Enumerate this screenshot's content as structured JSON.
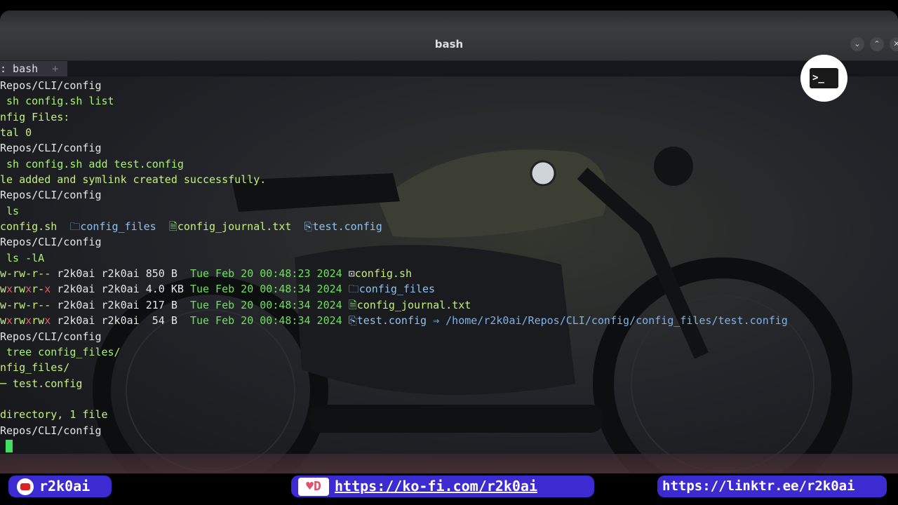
{
  "window": {
    "title": "bash",
    "buttons": [
      "⌄",
      "⌃",
      "✕"
    ]
  },
  "tabs": {
    "active_label": ": bash",
    "new_tab": "+"
  },
  "terminal_lines": [
    [
      {
        "t": "Repos/CLI/config",
        "c": "w"
      }
    ],
    [
      {
        "t": " sh config.sh list",
        "c": "g"
      }
    ],
    [
      {
        "t": "nfig Files:",
        "c": "gt"
      }
    ],
    [
      {
        "t": "tal 0",
        "c": "gt"
      }
    ],
    [
      {
        "t": "Repos/CLI/config",
        "c": "w"
      }
    ],
    [
      {
        "t": " sh config.sh add test.config",
        "c": "g"
      }
    ],
    [
      {
        "t": "le added and symlink created successfully.",
        "c": "gt"
      }
    ],
    [
      {
        "t": "Repos/CLI/config",
        "c": "w"
      }
    ],
    [
      {
        "t": " ls",
        "c": "g"
      }
    ],
    [
      {
        "t": "config.sh ",
        "c": "gt"
      },
      {
        "t": " 🗀config_files ",
        "c": "b"
      },
      {
        "t": " 🗎",
        "c": "d"
      },
      {
        "t": "config_journal.txt ",
        "c": "gt"
      },
      {
        "t": " ⎘test.config",
        "c": "b"
      }
    ],
    [
      {
        "t": "Repos/CLI/config",
        "c": "w"
      }
    ],
    [
      {
        "t": " ls -lA",
        "c": "g"
      }
    ],
    [
      {
        "t": "w-rw-r-- ",
        "c": "gt"
      },
      {
        "t": "r2k0ai r2k0ai 850 B  ",
        "c": "w"
      },
      {
        "t": "Tue Feb 20 00:48:23 2024 ",
        "c": "d"
      },
      {
        "t": "⊡",
        "c": "w"
      },
      {
        "t": "config.sh",
        "c": "gt"
      }
    ],
    [
      {
        "t": "w",
        "c": "gt"
      },
      {
        "t": "x",
        "c": "r"
      },
      {
        "t": "rw",
        "c": "gt"
      },
      {
        "t": "x",
        "c": "r"
      },
      {
        "t": "r-",
        "c": "gt"
      },
      {
        "t": "x ",
        "c": "r"
      },
      {
        "t": "r2k0ai r2k0ai 4.0 KB ",
        "c": "w"
      },
      {
        "t": "Tue Feb 20 00:48:34 2024 ",
        "c": "d"
      },
      {
        "t": "🗀config_files",
        "c": "b"
      }
    ],
    [
      {
        "t": "w-rw-r-- ",
        "c": "gt"
      },
      {
        "t": "r2k0ai r2k0ai 217 B  ",
        "c": "w"
      },
      {
        "t": "Tue Feb 20 00:48:34 2024 ",
        "c": "d"
      },
      {
        "t": "🗎",
        "c": "d"
      },
      {
        "t": "config_journal.txt",
        "c": "gt"
      }
    ],
    [
      {
        "t": "w",
        "c": "gt"
      },
      {
        "t": "x",
        "c": "r"
      },
      {
        "t": "rw",
        "c": "gt"
      },
      {
        "t": "x",
        "c": "r"
      },
      {
        "t": "rw",
        "c": "gt"
      },
      {
        "t": "x ",
        "c": "r"
      },
      {
        "t": "r2k0ai r2k0ai  54 B  ",
        "c": "w"
      },
      {
        "t": "Tue Feb 20 00:48:34 2024 ",
        "c": "d"
      },
      {
        "t": "⎘test.config ⇒ ",
        "c": "b"
      },
      {
        "t": "/home/r2k0ai/Repos/CLI/config/config_files/test.config",
        "c": "bl"
      }
    ],
    [
      {
        "t": "Repos/CLI/config",
        "c": "w"
      }
    ],
    [
      {
        "t": " tree config_files/",
        "c": "g"
      }
    ],
    [
      {
        "t": "nfig_files/",
        "c": "gt"
      }
    ],
    [
      {
        "t": "─ test.config",
        "c": "gt"
      }
    ],
    [
      {
        "t": " ",
        "c": "w"
      }
    ],
    [
      {
        "t": "directory, 1 file",
        "c": "gt"
      }
    ],
    [
      {
        "t": "Repos/CLI/config",
        "c": "w"
      }
    ]
  ],
  "badge": {
    "icon": "terminal-icon",
    "glyph": ">_"
  },
  "footer": {
    "youtube": "r2k0ai",
    "kofi": "https://ko-fi.com/r2k0ai",
    "linktree": "https://linktr.ee/r2k0ai"
  },
  "colors": {
    "accent_pill": "#3b2bd1",
    "cursor": "#40e060"
  }
}
